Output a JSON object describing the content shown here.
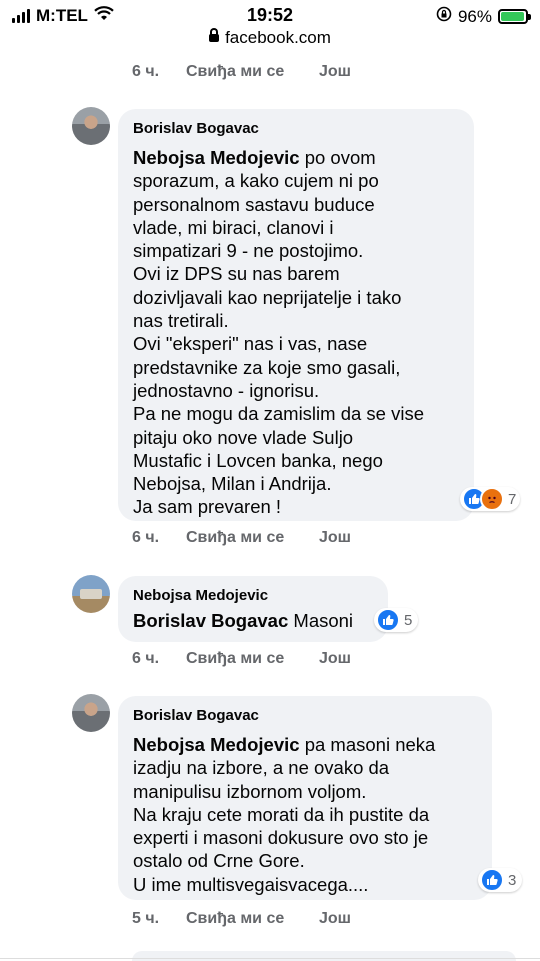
{
  "status_bar": {
    "carrier": "M:TEL",
    "time": "19:52",
    "battery": "96%"
  },
  "address_bar": {
    "url": "facebook.com"
  },
  "actions_labels": {
    "like": "Свиђа ми се",
    "more": "Још"
  },
  "top_actions": {
    "time": "6 ч."
  },
  "comments": [
    {
      "author": "Borislav Bogavac",
      "mention": "Nebojsa Medojevic",
      "text": " po ovom\nsporazum, a kako cujem ni po\npersonalnom sastavu buduce\nvlade, mi biraci, clanovi i\nsimpatizari 9 - ne postojimo.\nOvi iz DPS su nas barem\ndozivljavali kao neprijatelje i tako\nnas tretirali.\nOvi \"eksperi\" nas i vas, nase\npredstavnike za koje smo gasali,\njednostavno - ignorisu.\nPa ne mogu da zamislim da se vise\npitaju oko nove vlade Suljo\nMustafic i Lovcen banka, nego\nNebojsa, Milan i Andrija.\nJa sam prevaren !",
      "reactions": [
        "like-icon",
        "angry-icon"
      ],
      "reaction_count": "7",
      "time": "6 ч."
    },
    {
      "author": "Nebojsa Medojevic",
      "mention": "Borislav Bogavac",
      "text": " Masoni",
      "reactions": [
        "like-icon"
      ],
      "reaction_count": "5",
      "time": "6 ч."
    },
    {
      "author": "Borislav Bogavac",
      "mention": "Nebojsa Medojevic",
      "text": " pa masoni neka\nizadju na izbore, a ne ovako da\nmanipulisu izbornom voljom.\nNa kraju cete morati da ih pustite da\nexperti i masoni dokusure ovo sto je\nostalo od Crne Gore.\nU ime multisvegaisvacega....",
      "reactions": [
        "like-icon"
      ],
      "reaction_count": "3",
      "time": "5 ч."
    }
  ],
  "colors": {
    "bubble": "#f0f2f5",
    "meta_text": "#65676b",
    "like_blue": "#1877f2",
    "angry_orange": "#e9710f",
    "battery_green": "#34c759"
  }
}
